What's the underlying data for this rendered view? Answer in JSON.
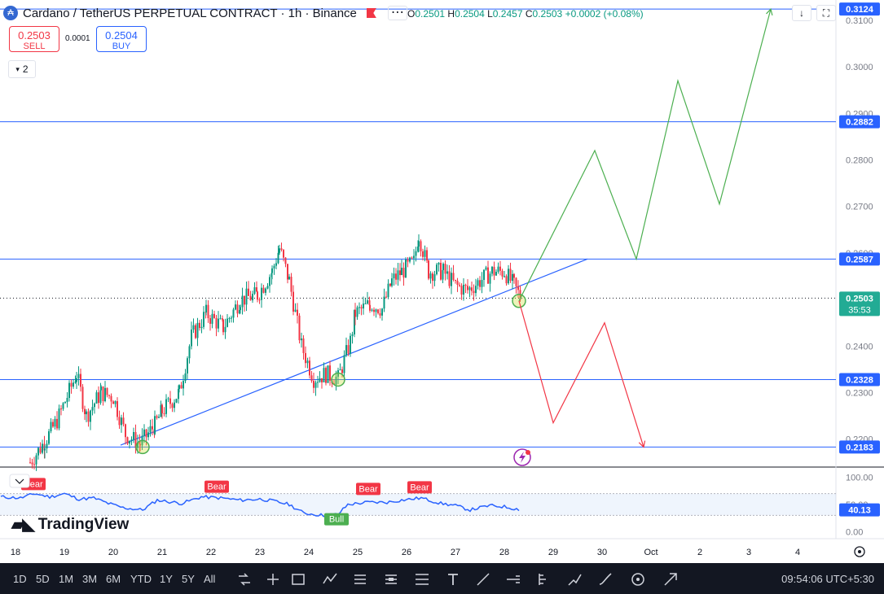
{
  "header": {
    "symbol": "Cardano / TetherUS PERPETUAL CONTRACT · 1h · Binance",
    "ohlc": {
      "o_label": "O",
      "o": "0.2501",
      "h_label": "H",
      "h": "0.2504",
      "l_label": "L",
      "l": "0.2457",
      "c_label": "C",
      "c": "0.2503",
      "change": "+0.0002 (+0.08%)"
    }
  },
  "trade": {
    "sell_price": "0.2503",
    "sell_label": "SELL",
    "spread": "0.0001",
    "buy_price": "0.2504",
    "buy_label": "BUY"
  },
  "indicator_count": "2",
  "colors": {
    "up": "#089981",
    "down": "#f23645",
    "level": "#2962ff",
    "proj_up": "#4caf50",
    "proj_down": "#f23645",
    "rsi": "#2962ff",
    "current": "#22ab94"
  },
  "chart_data": {
    "type": "candlestick",
    "x_ticks": [
      "18",
      "19",
      "20",
      "21",
      "22",
      "23",
      "24",
      "25",
      "26",
      "27",
      "28",
      "29",
      "30",
      "Oct",
      "2",
      "3",
      "4"
    ],
    "y_ticks": [
      "0.3100",
      "0.3000",
      "0.2900",
      "0.2800",
      "0.2700",
      "0.2600",
      "0.2500",
      "0.2400",
      "0.2300",
      "0.2200"
    ],
    "ylim": [
      0.214,
      0.314
    ],
    "horizontal_levels": [
      "0.3124",
      "0.2882",
      "0.2587",
      "0.2328",
      "0.2183"
    ],
    "current_price": "0.2503",
    "countdown": "35:53",
    "trendline": {
      "from": {
        "day": 20.15,
        "price": 0.2187
      },
      "to": {
        "day": 29.7,
        "price": 0.2587
      }
    },
    "touch_points": [
      {
        "day": 20.6,
        "price": 0.2183
      },
      {
        "day": 24.6,
        "price": 0.2328
      },
      {
        "day": 28.3,
        "price": 0.2497
      }
    ],
    "candle_path": [
      [
        18.3,
        0.215
      ],
      [
        18.6,
        0.2195
      ],
      [
        18.85,
        0.224
      ],
      [
        19.25,
        0.234
      ],
      [
        19.45,
        0.225
      ],
      [
        19.75,
        0.23
      ],
      [
        20.0,
        0.229
      ],
      [
        20.25,
        0.221
      ],
      [
        20.55,
        0.219
      ],
      [
        20.85,
        0.223
      ],
      [
        21.0,
        0.226
      ],
      [
        21.35,
        0.23
      ],
      [
        21.6,
        0.242
      ],
      [
        21.9,
        0.247
      ],
      [
        22.25,
        0.244
      ],
      [
        22.6,
        0.25
      ],
      [
        22.95,
        0.251
      ],
      [
        23.25,
        0.256
      ],
      [
        23.4,
        0.261
      ],
      [
        23.6,
        0.254
      ],
      [
        23.85,
        0.24
      ],
      [
        24.1,
        0.233
      ],
      [
        24.35,
        0.234
      ],
      [
        24.6,
        0.233
      ],
      [
        24.85,
        0.241
      ],
      [
        24.95,
        0.247
      ],
      [
        25.25,
        0.249
      ],
      [
        25.5,
        0.248
      ],
      [
        25.7,
        0.254
      ],
      [
        25.9,
        0.256
      ],
      [
        26.15,
        0.258
      ],
      [
        26.25,
        0.264
      ],
      [
        26.45,
        0.256
      ],
      [
        26.75,
        0.256
      ],
      [
        27.0,
        0.253
      ],
      [
        27.25,
        0.252
      ],
      [
        27.5,
        0.254
      ],
      [
        27.75,
        0.256
      ],
      [
        28.0,
        0.256
      ],
      [
        28.2,
        0.253
      ],
      [
        28.35,
        0.25
      ]
    ],
    "projection_bullish": [
      [
        28.3,
        0.2497
      ],
      [
        29.85,
        0.282
      ],
      [
        30.7,
        0.2587
      ],
      [
        31.55,
        0.297
      ],
      [
        32.4,
        0.2705
      ],
      [
        33.45,
        0.3124
      ]
    ],
    "projection_bearish": [
      [
        28.3,
        0.2497
      ],
      [
        29.0,
        0.2235
      ],
      [
        30.05,
        0.245
      ],
      [
        30.85,
        0.2183
      ]
    ],
    "rsi": {
      "y_ticks": [
        "100.00",
        "50.00",
        "0.00"
      ],
      "current": "40.13",
      "ylim": [
        -10,
        110
      ],
      "band": [
        30,
        70
      ],
      "path": [
        [
          17.7,
          64
        ],
        [
          18.1,
          62
        ],
        [
          18.4,
          70
        ],
        [
          18.7,
          64
        ],
        [
          19.0,
          70
        ],
        [
          19.3,
          60
        ],
        [
          19.6,
          62
        ],
        [
          19.9,
          52
        ],
        [
          20.2,
          44
        ],
        [
          20.6,
          40
        ],
        [
          20.9,
          58
        ],
        [
          21.4,
          52
        ],
        [
          21.8,
          64
        ],
        [
          22.2,
          62
        ],
        [
          22.6,
          58
        ],
        [
          23.0,
          60
        ],
        [
          23.3,
          56
        ],
        [
          23.6,
          50
        ],
        [
          23.9,
          34
        ],
        [
          24.3,
          30
        ],
        [
          24.6,
          32
        ],
        [
          24.8,
          50
        ],
        [
          25.2,
          54
        ],
        [
          25.6,
          54
        ],
        [
          25.9,
          58
        ],
        [
          26.3,
          62
        ],
        [
          26.7,
          52
        ],
        [
          27.0,
          48
        ],
        [
          27.3,
          40
        ],
        [
          27.7,
          48
        ],
        [
          28.0,
          46
        ],
        [
          28.35,
          40
        ]
      ],
      "signals": [
        {
          "label": "Bear",
          "day": 18.35,
          "value": 75,
          "kind": "bear"
        },
        {
          "label": "Bear",
          "day": 22.1,
          "value": 70,
          "kind": "bear"
        },
        {
          "label": "Bull",
          "day": 24.55,
          "value": 10,
          "kind": "bull"
        },
        {
          "label": "Bear",
          "day": 25.2,
          "value": 66,
          "kind": "bear"
        },
        {
          "label": "Bear",
          "day": 26.25,
          "value": 69,
          "kind": "bear"
        }
      ]
    }
  },
  "brand": "TradingView",
  "toolbar": {
    "timeframes": [
      "1D",
      "5D",
      "1M",
      "3M",
      "6M",
      "YTD",
      "1Y",
      "5Y",
      "All"
    ],
    "clock": "09:54:06 UTC+5:30"
  }
}
